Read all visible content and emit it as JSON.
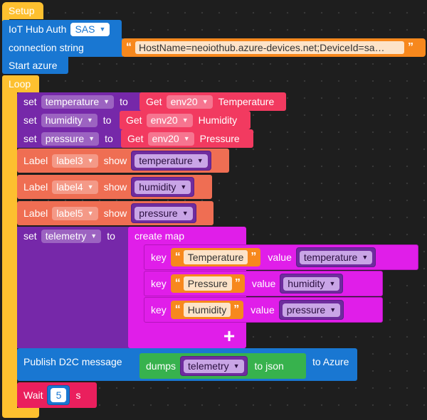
{
  "setup": {
    "label": "Setup"
  },
  "iot_hub": {
    "label": "IoT Hub Auth",
    "auth_type": "SAS",
    "connection_label": "connection string",
    "connection_value": "HostName=neoiothub.azure-devices.net;DeviceId=sa…"
  },
  "start": {
    "label": "Start azure"
  },
  "loop": {
    "label": "Loop",
    "set_word": "set",
    "to_word": "to",
    "sets": [
      {
        "variable": "temperature",
        "get_label": "Get",
        "sensor": "env20",
        "field": "Temperature"
      },
      {
        "variable": "humidity",
        "get_label": "Get",
        "sensor": "env20",
        "field": "Humidity"
      },
      {
        "variable": "pressure",
        "get_label": "Get",
        "sensor": "env20",
        "field": "Pressure"
      }
    ],
    "label_word": "Label",
    "show_word": "show",
    "labels": [
      {
        "target": "label3",
        "value": "temperature"
      },
      {
        "target": "label4",
        "value": "humidity"
      },
      {
        "target": "label5",
        "value": "pressure"
      }
    ],
    "telemetry": {
      "variable": "telemetry",
      "create_label": "create map",
      "key_word": "key",
      "value_word": "value",
      "entries": [
        {
          "key": "Temperature",
          "value": "temperature"
        },
        {
          "key": "Pressure",
          "value": "humidity"
        },
        {
          "key": "Humidity",
          "value": "pressure"
        }
      ],
      "add_symbol": "+"
    },
    "publish": {
      "label": "Publish D2C message",
      "dumps_label": "dumps",
      "variable": "telemetry",
      "to_json_label": "to json",
      "to_azure_label": "to Azure"
    },
    "wait": {
      "label": "Wait",
      "value": "5",
      "unit": "s"
    }
  },
  "icons": {
    "quote_open": "“",
    "quote_close": "”",
    "dropdown": "▼"
  },
  "colors": {
    "setup": "#fdc02f",
    "azure": "#1977d2",
    "variable": "#7628a9",
    "sensor": "#f23a60",
    "label": "#ef6e53",
    "map": "#e01ee9",
    "json": "#37b24d",
    "string": "#f7881d",
    "wait": "#ea1f5d"
  }
}
